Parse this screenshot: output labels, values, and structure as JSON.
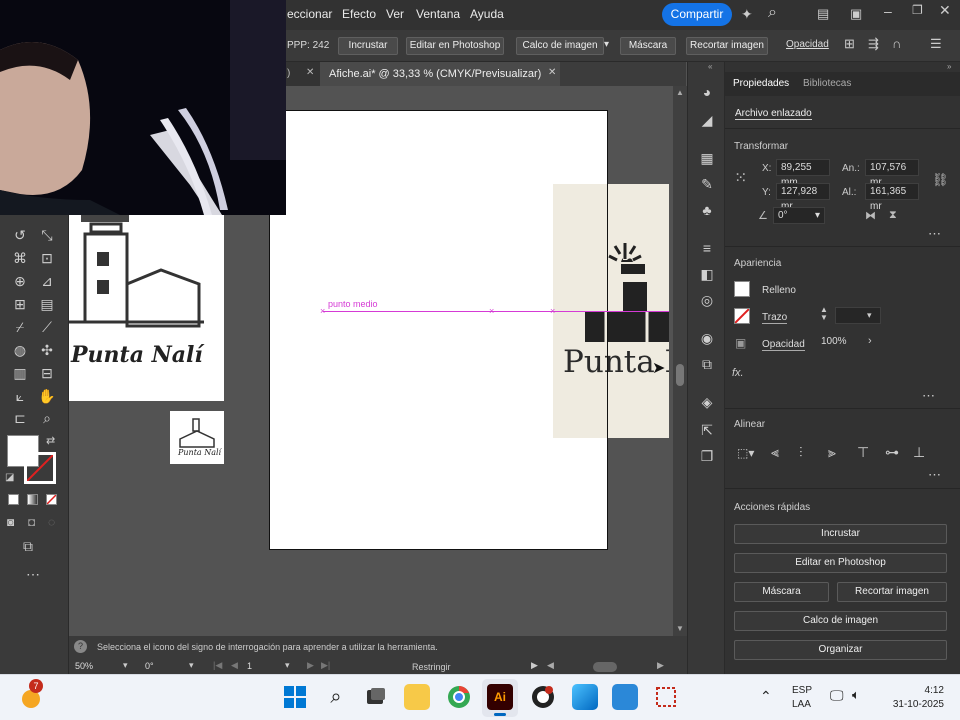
{
  "menubar": {
    "items": [
      "eccionar",
      "Efecto",
      "Ver",
      "Ventana",
      "Ayuda"
    ],
    "share_button": "Compartir"
  },
  "controlbar": {
    "ppp": "PPP: 242",
    "buttons": [
      "Incrustar",
      "Editar en Photoshop",
      "Calco de imagen",
      "Máscara",
      "Recortar imagen",
      "Opacidad"
    ]
  },
  "tabs": {
    "prev_tab_suffix": ")",
    "active_tab": "Afiche.ai* @ 33,33 % (CMYK/Previsualizar)"
  },
  "canvas": {
    "guide_label": "punto medio",
    "thumb_text": "Punta Nalí",
    "artwork_text": "Punta N"
  },
  "status": {
    "hint": "Selecciona el icono del signo de interrogación para aprender a utilizar la herramienta.",
    "zoom": "50%",
    "rotation": "0°",
    "artboard": "1",
    "constrain": "Restringir"
  },
  "properties": {
    "tabs": [
      "Propiedades",
      "Bibliotecas"
    ],
    "linked_file": "Archivo enlazado",
    "transform": {
      "title": "Transformar",
      "x_label": "X:",
      "x_value": "89,255 mm",
      "y_label": "Y:",
      "y_value": "127,928 mr",
      "w_label": "An.:",
      "w_value": "107,576 mr",
      "h_label": "Al.:",
      "h_value": "161,365 mr",
      "angle_value": "0°"
    },
    "appearance": {
      "title": "Apariencia",
      "fill": "Relleno",
      "stroke": "Trazo",
      "opacity_label": "Opacidad",
      "opacity_value": "100%"
    },
    "align": {
      "title": "Alinear"
    },
    "quick_actions": {
      "title": "Acciones rápidas",
      "embed": "Incrustar",
      "edit_ps": "Editar en Photoshop",
      "mask": "Máscara",
      "crop": "Recortar imagen",
      "trace": "Calco de imagen",
      "arrange": "Organizar"
    }
  },
  "taskbar": {
    "notif_badge": "7",
    "lang_1": "ESP",
    "lang_2": "LAA",
    "time": "4:12",
    "date": "31-10-2025"
  },
  "colors": {
    "accent": "#1473e6",
    "guide": "#d53ad5",
    "artwork_bg": "#efebe0"
  }
}
